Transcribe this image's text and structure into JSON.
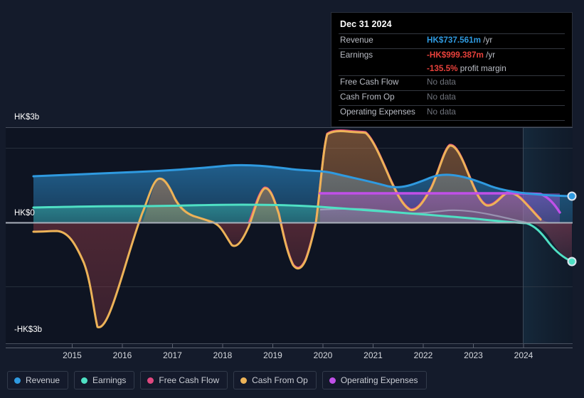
{
  "tooltip": {
    "date": "Dec 31 2024",
    "rows": [
      {
        "label": "Revenue",
        "value": "HK$737.561m",
        "unit": "/yr",
        "style": "blue"
      },
      {
        "label": "Earnings",
        "value": "-HK$999.387m",
        "unit": "/yr",
        "style": "red"
      },
      {
        "label": "Free Cash Flow",
        "value": "No data",
        "unit": "",
        "style": "nodata"
      },
      {
        "label": "Cash From Op",
        "value": "No data",
        "unit": "",
        "style": "nodata"
      },
      {
        "label": "Operating Expenses",
        "value": "No data",
        "unit": "",
        "style": "nodata"
      }
    ],
    "margin_value": "-135.5%",
    "margin_label": "profit margin"
  },
  "legend": [
    {
      "label": "Revenue",
      "color": "#2f9ae0"
    },
    {
      "label": "Earnings",
      "color": "#4fe0c4"
    },
    {
      "label": "Free Cash Flow",
      "color": "#e0487f"
    },
    {
      "label": "Cash From Op",
      "color": "#eeb košt"
    },
    {
      "label": "Operating Expenses",
      "color": "#c050e8"
    }
  ],
  "axis": {
    "y_top_label": "HK$3b",
    "y_zero_label": "HK$0",
    "y_bottom_label": "-HK$3b"
  },
  "chart_data": {
    "type": "area",
    "title": "",
    "xlabel": "",
    "ylabel": "HK$",
    "currency": "HK$",
    "ylim": [
      -3000000000,
      3000000000
    ],
    "ytick_labels": [
      "HK$3b",
      "HK$0",
      "-HK$3b"
    ],
    "ytick_values": [
      3000000000,
      0,
      -3000000000
    ],
    "x_tick_labels": [
      "2015",
      "2016",
      "2017",
      "2018",
      "2019",
      "2020",
      "2021",
      "2022",
      "2023",
      "2024"
    ],
    "x_tick_values": [
      2015,
      2016,
      2017,
      2018,
      2019,
      2020,
      2021,
      2022,
      2023,
      2024
    ],
    "x_range": [
      2014.25,
      2025.2
    ],
    "grid": true,
    "legend_position": "bottom",
    "forecast_region_start": 2024,
    "series": [
      {
        "name": "Revenue",
        "color": "#2f9ae0",
        "x": [
          2014.25,
          2015,
          2016,
          2017,
          2018,
          2018.5,
          2019,
          2020,
          2020.5,
          2021,
          2021.5,
          2022,
          2023,
          2024,
          2025.2
        ],
        "values": [
          1.45,
          1.48,
          1.52,
          1.55,
          1.58,
          1.6,
          1.55,
          1.5,
          1.38,
          1.42,
          1.52,
          1.4,
          1.18,
          0.9,
          0.738
        ],
        "unit": "HK$b",
        "endpoint_value": "HK$737.561m"
      },
      {
        "name": "Earnings",
        "color": "#4fe0c4",
        "x": [
          2014.25,
          2015,
          2016,
          2017,
          2018,
          2019,
          2020,
          2021,
          2022,
          2023,
          2024,
          2024.5,
          2025.2
        ],
        "values": [
          0.5,
          0.51,
          0.52,
          0.5,
          0.51,
          0.5,
          0.46,
          0.33,
          0.22,
          0.05,
          -0.05,
          -0.45,
          -0.999
        ],
        "unit": "HK$b",
        "endpoint_value": "-HK$999.387m"
      },
      {
        "name": "Free Cash Flow",
        "color": "#e0487f",
        "x": [
          2018.0,
          2018.5,
          2019.0,
          2019.6,
          2019.9,
          2020.0,
          2020.6,
          2021.4,
          2022.0,
          2022.5,
          2023.0,
          2023.5,
          2024.0,
          2024.4
        ],
        "values": [
          -0.45,
          0.75,
          -0.3,
          -1.4,
          -1.3,
          2.9,
          2.92,
          0.55,
          1.1,
          2.05,
          1.0,
          0.65,
          0.88,
          0.6
        ],
        "unit": "HK$b",
        "note": "overlaps Cash From Op"
      },
      {
        "name": "Cash From Op",
        "color": "#edb358",
        "x": [
          2014.25,
          2014.6,
          2014.8,
          2015.5,
          2016.2,
          2016.5,
          2017.0,
          2017.5,
          2018.0,
          2018.5,
          2019.0,
          2019.6,
          2019.9,
          2020.0,
          2020.6,
          2021.4,
          2022.0,
          2022.5,
          2023.0,
          2023.5,
          2024.0,
          2024.4
        ],
        "values": [
          -0.3,
          -0.3,
          -0.55,
          -2.95,
          0.05,
          1.55,
          0.35,
          0.05,
          -0.45,
          0.75,
          -0.3,
          -1.4,
          -1.3,
          2.9,
          2.92,
          0.55,
          1.1,
          2.05,
          1.0,
          0.65,
          0.88,
          0.6
        ],
        "unit": "HK$b"
      },
      {
        "name": "Operating Expenses",
        "color": "#c050e8",
        "x": [
          2020.0,
          2021.0,
          2022.0,
          2023.0,
          2024.0,
          2024.6
        ],
        "values": [
          0.92,
          0.92,
          0.92,
          0.92,
          0.92,
          0.37
        ],
        "unit": "HK$b"
      }
    ]
  }
}
